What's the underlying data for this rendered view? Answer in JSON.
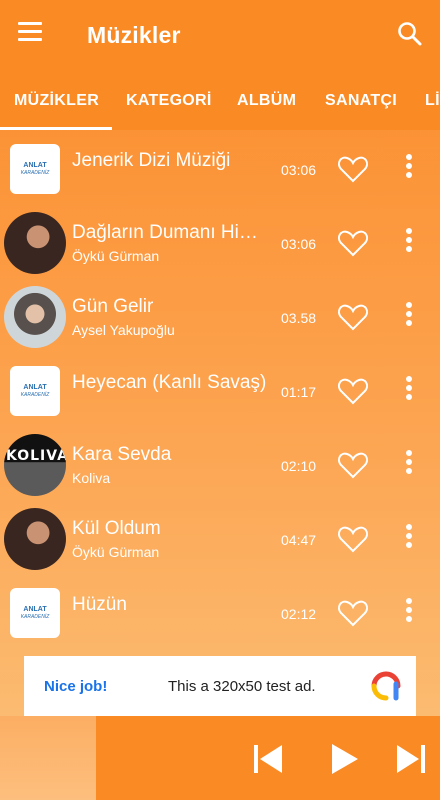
{
  "app": {
    "title": "Müzikler"
  },
  "tabs": [
    {
      "label": "MÜZİKLER",
      "active": true
    },
    {
      "label": "KATEGORİ",
      "active": false
    },
    {
      "label": "ALBÜM",
      "active": false
    },
    {
      "label": "SANATÇI",
      "active": false
    },
    {
      "label": "Lİ",
      "active": false
    }
  ],
  "songs": [
    {
      "title": "Jenerik Dizi Müziği",
      "artist": "",
      "duration": "03:06",
      "thumb": "app-logo"
    },
    {
      "title": "Dağların Dumanı Hiç…",
      "artist": "Öykü Gürman",
      "duration": "03:06",
      "thumb": "photo"
    },
    {
      "title": "Gün Gelir",
      "artist": "Aysel Yakupoğlu",
      "duration": "03.58",
      "thumb": "photo"
    },
    {
      "title": "Heyecan (Kanlı Savaş)",
      "artist": "",
      "duration": "01:17",
      "thumb": "app-logo"
    },
    {
      "title": "Kara Sevda",
      "artist": "Koliva",
      "duration": "02:10",
      "thumb": "band"
    },
    {
      "title": "Kül Oldum",
      "artist": "Öykü Gürman",
      "duration": "04:47",
      "thumb": "photo"
    },
    {
      "title": "Hüzün",
      "artist": "",
      "duration": "02:12",
      "thumb": "app-logo"
    }
  ],
  "logo": {
    "line1": "ANLAT",
    "line2": "KARADENİZ"
  },
  "band_logo_text": "KOLIVA",
  "ad": {
    "nice": "Nice job!",
    "text": "This a 320x50 test ad."
  },
  "icons": {
    "menu": "menu-icon",
    "search": "search-icon",
    "heart": "heart-outline-icon",
    "more": "more-vert-icon",
    "prev": "skip-previous-icon",
    "play": "play-icon",
    "next": "skip-next-icon"
  },
  "colors": {
    "accent": "#f98a24",
    "text": "#ffffff",
    "ad_link": "#1a73e8"
  }
}
